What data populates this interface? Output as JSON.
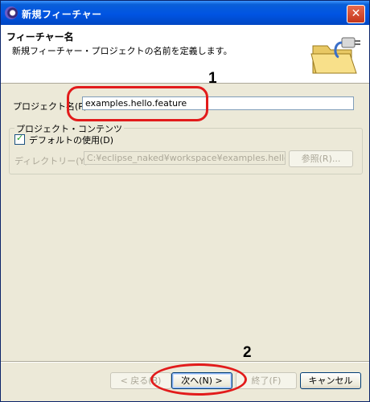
{
  "window": {
    "title": "新規フィーチャー",
    "close_icon": "close-icon"
  },
  "header": {
    "title": "フィーチャー名",
    "description": "新規フィーチャー・プロジェクトの名前を定義します。",
    "banner_icon": "folder-plug-icon"
  },
  "form": {
    "project_name_label": "プロジェクト名(P):",
    "project_name_value": "examples.hello.feature",
    "group_label": "プロジェクト・コンテンツ",
    "use_default_label": "デフォルトの使用(D)",
    "use_default_checked": true,
    "directory_label": "ディレクトリー(Y):",
    "directory_value": "C:¥eclipse_naked¥workspace¥examples.hello.feature",
    "browse_label": "参照(R)..."
  },
  "buttons": {
    "back": "< 戻る(B)",
    "next": "次へ(N) >",
    "finish": "終了(F)",
    "cancel": "キャンセル"
  },
  "annotations": {
    "one": "1",
    "two": "2",
    "color": "#e21b1b"
  }
}
